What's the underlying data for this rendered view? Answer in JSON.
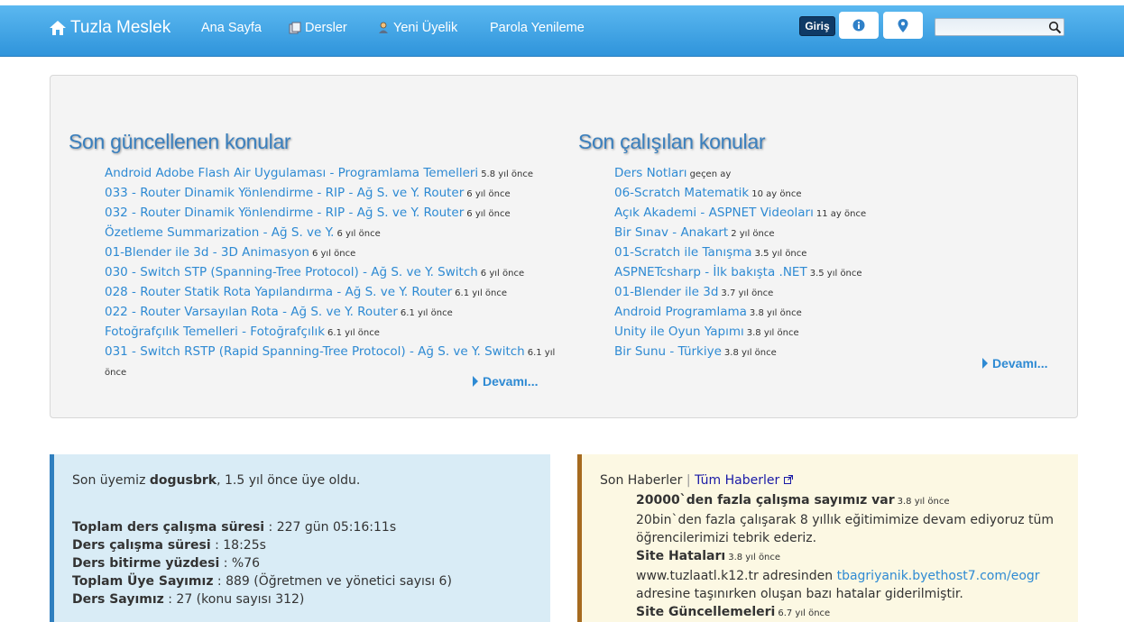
{
  "nav": {
    "brand": "Tuzla Meslek",
    "links": [
      "Ana Sayfa",
      "Dersler",
      "Yeni Üyelik",
      "Parola Yenileme"
    ],
    "login": "Giriş"
  },
  "recent_updated": {
    "title": "Son güncellenen konular",
    "items": [
      {
        "text": "Android Adobe Flash Air Uygulaması - Programlama Temelleri",
        "age": "5.8 yıl önce"
      },
      {
        "text": "033 - Router Dinamik Yönlendirme - RIP - Ağ S. ve Y. Router",
        "age": "6 yıl önce"
      },
      {
        "text": "032 - Router Dinamik Yönlendirme - RIP - Ağ S. ve Y. Router",
        "age": "6 yıl önce"
      },
      {
        "text": "Özetleme Summarization - Ağ S. ve Y.",
        "age": "6 yıl önce"
      },
      {
        "text": "01-Blender ile 3d - 3D Animasyon",
        "age": "6 yıl önce"
      },
      {
        "text": "030 - Switch STP (Spanning-Tree Protocol) - Ağ S. ve Y. Switch",
        "age": "6 yıl önce"
      },
      {
        "text": "028 - Router Statik Rota Yapılandırma - Ağ S. ve Y. Router",
        "age": "6.1 yıl önce"
      },
      {
        "text": "022 - Router Varsayılan Rota - Ağ S. ve Y. Router",
        "age": "6.1 yıl önce"
      },
      {
        "text": "Fotoğrafçılık Temelleri - Fotoğrafçılık",
        "age": "6.1 yıl önce"
      },
      {
        "text": "031 - Switch RSTP (Rapid Spanning-Tree Protocol) - Ağ S. ve Y. Switch",
        "age": "6.1 yıl önce"
      }
    ],
    "more": "Devamı..."
  },
  "recent_studied": {
    "title": "Son çalışılan konular",
    "items": [
      {
        "text": "Ders Notları",
        "age": "geçen ay"
      },
      {
        "text": "06-Scratch Matematik",
        "age": "10 ay önce"
      },
      {
        "text": "Açık Akademi - ASPNET Videoları",
        "age": "11 ay önce"
      },
      {
        "text": "Bir Sınav - Anakart",
        "age": "2 yıl önce"
      },
      {
        "text": "01-Scratch ile Tanışma",
        "age": "3.5 yıl önce"
      },
      {
        "text": "ASPNETcsharp - İlk bakışta .NET",
        "age": "3.5 yıl önce"
      },
      {
        "text": "01-Blender ile 3d",
        "age": "3.7 yıl önce"
      },
      {
        "text": "Android Programlama",
        "age": "3.8 yıl önce"
      },
      {
        "text": "Unity ile Oyun Yapımı",
        "age": "3.8 yıl önce"
      },
      {
        "text": "Bir Sunu - Türkiye",
        "age": "3.8 yıl önce"
      }
    ],
    "more": "Devamı..."
  },
  "stats": {
    "intro_prefix": "Son üyemiz ",
    "member": "dogusbrk",
    "intro_suffix": ", 1.5 yıl önce üye oldu.",
    "lines": [
      {
        "label": "Toplam ders çalışma süresi",
        "value": " : 227 gün 05:16:11s"
      },
      {
        "label": "Ders çalışma süresi",
        "value": " : 18:25s"
      },
      {
        "label": "Ders bitirme yüzdesi",
        "value": " : %76"
      },
      {
        "label": "Toplam Üye Sayımız",
        "value": " : 889 (Öğretmen ve yönetici sayısı 6)"
      },
      {
        "label": "Ders Sayımız",
        "value": " : 27 (konu sayısı 312)"
      }
    ]
  },
  "news": {
    "head": "Son Haberler",
    "sep": " | ",
    "all_link": "Tüm Haberler",
    "item1_title": "20000`den fazla çalışma sayımız var",
    "item1_age": "3.8 yıl önce",
    "item1_body": "20bin`den fazla çalışarak 8 yıllık eğitimimize devam ediyoruz tüm öğrencilerimizi tebrik ederiz.",
    "item2_title": "Site Hataları",
    "item2_age": "3.8 yıl önce",
    "item2_body_a": "www.tuzlaatl.k12.tr adresinden ",
    "item2_link": "tbagriyanik.byethost7.com/eogr",
    "item2_body_b": " adresine taşınırken oluşan bazı hatalar giderilmiştir.",
    "item3_title": "Site Güncellemeleri",
    "item3_age": "6.7 yıl önce"
  }
}
